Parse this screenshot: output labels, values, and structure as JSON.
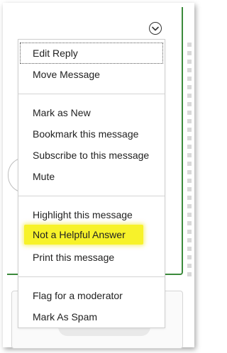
{
  "menu": {
    "groups": [
      {
        "items": [
          {
            "label": "Edit Reply"
          },
          {
            "label": "Move Message"
          }
        ]
      },
      {
        "items": [
          {
            "label": "Mark as New"
          },
          {
            "label": "Bookmark this message"
          },
          {
            "label": "Subscribe to this message"
          },
          {
            "label": "Mute"
          }
        ]
      },
      {
        "items": [
          {
            "label": "Highlight this message"
          },
          {
            "label": "Not a Helpful Answer"
          },
          {
            "label": "Print this message"
          }
        ]
      },
      {
        "items": [
          {
            "label": "Flag for a moderator"
          },
          {
            "label": "Mark As Spam"
          }
        ]
      }
    ]
  },
  "colors": {
    "accent_border": "#3b8a3b",
    "highlight": "#f7f22a"
  },
  "icons": {
    "options_toggle": "chevron-down-icon"
  }
}
